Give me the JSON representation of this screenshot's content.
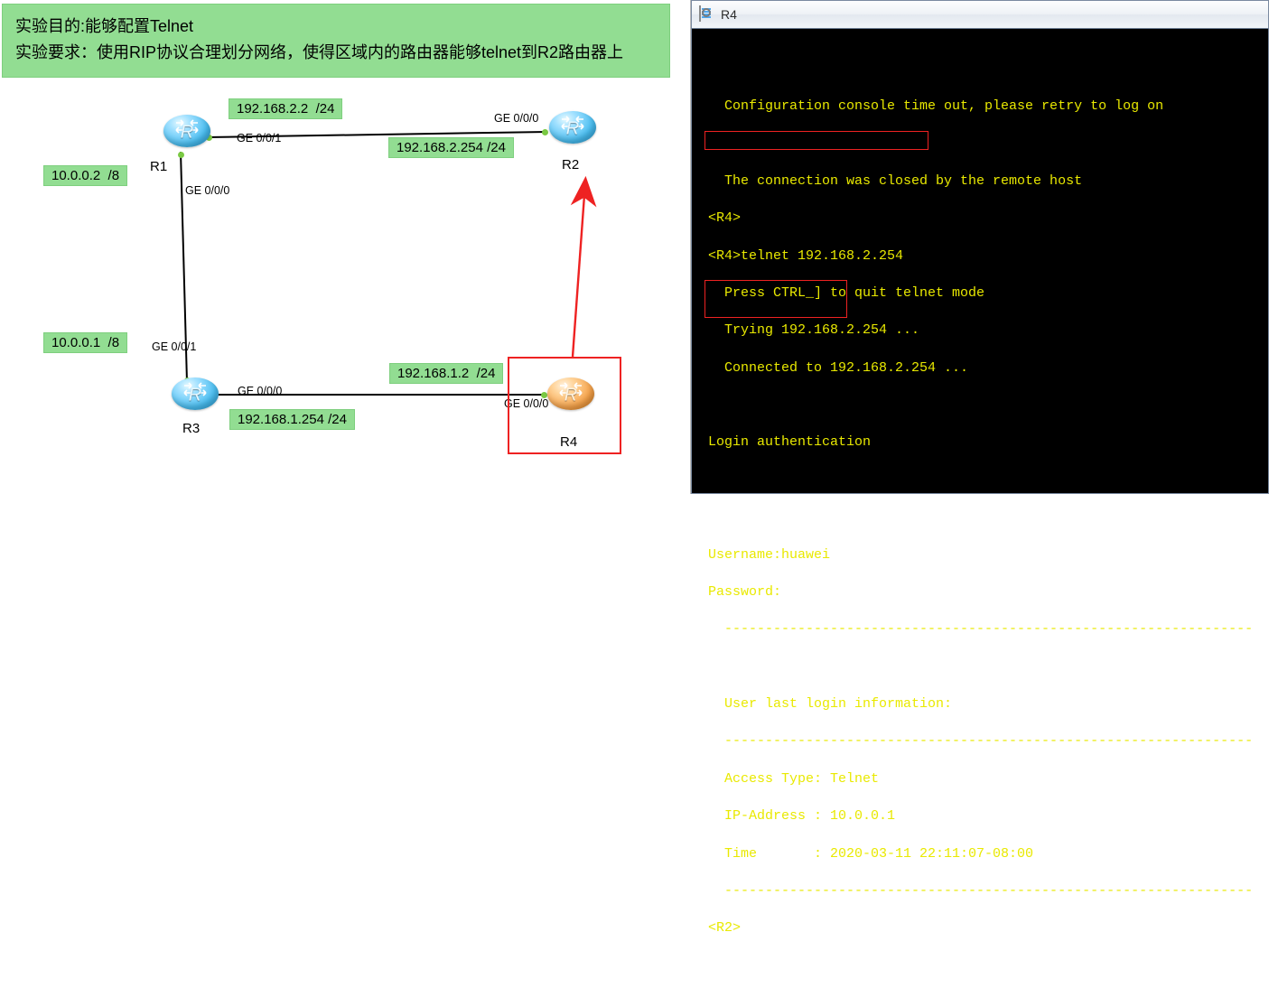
{
  "banner": {
    "line1": "实验目的:能够配置Telnet",
    "line2": "实验要求：使用RIP协议合理划分网络，使得区域内的路由器能够telnet到R2路由器上"
  },
  "topology": {
    "routers": {
      "r1": {
        "label": "R1",
        "glyph": "R"
      },
      "r2": {
        "label": "R2",
        "glyph": "R"
      },
      "r3": {
        "label": "R3",
        "glyph": "R"
      },
      "r4": {
        "label": "R4",
        "glyph": "R"
      }
    },
    "ip_tags": {
      "r1_top": "192.168.2.2  /24",
      "r2_top": "192.168.2.254 /24",
      "r1_left": "10.0.0.2  /8",
      "r3_left": "10.0.0.1  /8",
      "r4_top": "192.168.1.2  /24",
      "r3_bot": "192.168.1.254 /24"
    },
    "ports": {
      "r1_ge001": "GE 0/0/1",
      "r1_ge000": "GE 0/0/0",
      "r2_ge000": "GE 0/0/0",
      "r3_ge001": "GE 0/0/1",
      "r3_ge000": "GE 0/0/0",
      "r4_ge000": "GE 0/0/0"
    }
  },
  "console": {
    "title": "R4",
    "lines": {
      "l0": "",
      "l1": "  Configuration console time out, please retry to log on",
      "l2": "",
      "l3": "  The connection was closed by the remote host",
      "l4": "<R4>",
      "l5": "<R4>telnet 192.168.2.254",
      "l6": "  Press CTRL_] to quit telnet mode",
      "l7": "  Trying 192.168.2.254 ...",
      "l8": "  Connected to 192.168.2.254 ...",
      "l9": "",
      "l10": "Login authentication",
      "l11": "",
      "l12": "",
      "l13": "Username:huawei",
      "l14": "Password:",
      "l15": "  -----------------------------------------------------------------",
      "l16": "",
      "l17": "  User last login information:",
      "l18": "  -----------------------------------------------------------------",
      "l19": "  Access Type: Telnet",
      "l20": "  IP-Address : 10.0.0.1",
      "l21": "  Time       : 2020-03-11 22:11:07-08:00",
      "l22": "  -----------------------------------------------------------------",
      "l23": "<R2>"
    }
  }
}
